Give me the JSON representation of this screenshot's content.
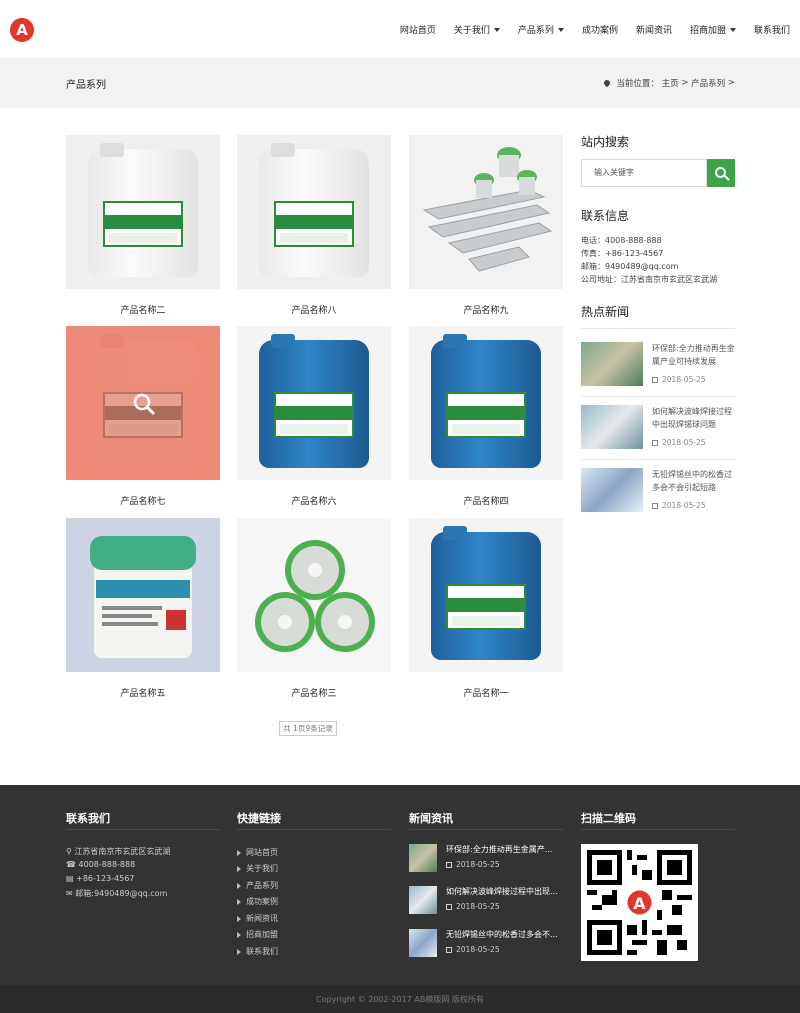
{
  "header": {
    "logo_letter": "A",
    "nav": [
      {
        "label": "网站首页",
        "dropdown": false
      },
      {
        "label": "关于我们",
        "dropdown": true
      },
      {
        "label": "产品系列",
        "dropdown": true
      },
      {
        "label": "成功案例",
        "dropdown": false
      },
      {
        "label": "新闻资讯",
        "dropdown": false
      },
      {
        "label": "招商加盟",
        "dropdown": true
      },
      {
        "label": "联系我们",
        "dropdown": false
      }
    ]
  },
  "banner": {
    "page_title": "产品系列",
    "crumb_prefix": "当前位置：",
    "crumb_home": "主页",
    "crumb_sep": ">",
    "crumb_current": "产品系列",
    "crumb_end": ">"
  },
  "products": [
    {
      "name": "产品名称二",
      "image": "white-jerrycan"
    },
    {
      "name": "产品名称八",
      "image": "white-jerrycan"
    },
    {
      "name": "产品名称九",
      "image": "solder-bars"
    },
    {
      "name": "产品名称七",
      "image": "white-jerrycan-hover"
    },
    {
      "name": "产品名称六",
      "image": "blue-jerrycan"
    },
    {
      "name": "产品名称四",
      "image": "blue-jerrycan"
    },
    {
      "name": "产品名称五",
      "image": "solder-paste-jar"
    },
    {
      "name": "产品名称三",
      "image": "solder-wire-spools"
    },
    {
      "name": "产品名称一",
      "image": "blue-jerrycan"
    }
  ],
  "pager": "共 1页9条记录",
  "sidebar": {
    "search_title": "站内搜索",
    "search_placeholder": "输入关键字",
    "contact_title": "联系信息",
    "contact_lines": [
      "电话：4008-888-888",
      "传真：+86-123-4567",
      "邮箱：9490489@qq.com",
      "公司地址：江苏省南京市玄武区玄武湖"
    ],
    "news_title": "热点新闻",
    "news": [
      {
        "title": "环保部:全力推动再生金属产业可持续发展",
        "date": "2018-05-25"
      },
      {
        "title": "如何解决波峰焊接过程中出现焊锡球问题",
        "date": "2018-05-25"
      },
      {
        "title": "无铅焊锡丝中的松香过多会不会引起短路",
        "date": "2018-05-25"
      }
    ]
  },
  "footer": {
    "contact_title": "联系我们",
    "contact": [
      {
        "icon": "map-pin-icon",
        "text": "江苏省南京市玄武区玄武湖"
      },
      {
        "icon": "phone-icon",
        "text": "4008-888-888"
      },
      {
        "icon": "fax-icon",
        "text": "+86-123-4567"
      },
      {
        "icon": "mail-icon",
        "text": "邮箱:9490489@qq.com"
      }
    ],
    "links_title": "快捷链接",
    "links": [
      "网站首页",
      "关于我们",
      "产品系列",
      "成功案例",
      "新闻资讯",
      "招商加盟",
      "联系我们"
    ],
    "news_title": "新闻资讯",
    "news": [
      {
        "title": "环保部:全力推动再生金属产...",
        "date": "2018-05-25"
      },
      {
        "title": "如何解决波峰焊接过程中出现...",
        "date": "2018-05-25"
      },
      {
        "title": "无铅焊锡丝中的松香过多会不...",
        "date": "2018-05-25"
      }
    ],
    "qr_title": "扫描二维码",
    "copyright": "Copyright © 2002-2017 AB模版网 版权所有"
  },
  "colors": {
    "brand_red": "#e4352a",
    "accent_green": "#3ea24a",
    "footer_bg": "#333333"
  }
}
